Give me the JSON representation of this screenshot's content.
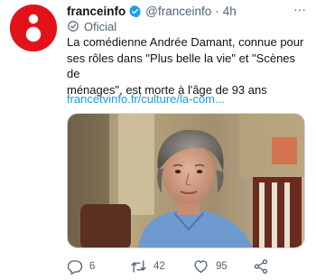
{
  "tweet": {
    "author_name": "franceinfo",
    "handle": "@franceinfo",
    "separator": "·",
    "time": "4h",
    "badge_label": "Oficial",
    "text_line1": "La comédienne Andrée Damant, connue pour",
    "text_line2": "ses rôles dans \"Plus belle la vie\" et \"Scènes de",
    "text_line3": "ménages\", est morte à l'âge de 93 ans",
    "link": "francetvinfo.fr/culture/la-com...",
    "more": "···"
  },
  "actions": {
    "replies": "6",
    "retweets": "42",
    "likes": "95"
  },
  "colors": {
    "brand": "#e2121b",
    "verified": "#1d9bf0",
    "link": "#1d9bf0",
    "muted": "#536471"
  },
  "icons": [
    "verified-badge-icon",
    "official-check-icon",
    "reply-icon",
    "retweet-icon",
    "like-icon",
    "share-icon",
    "more-icon"
  ]
}
